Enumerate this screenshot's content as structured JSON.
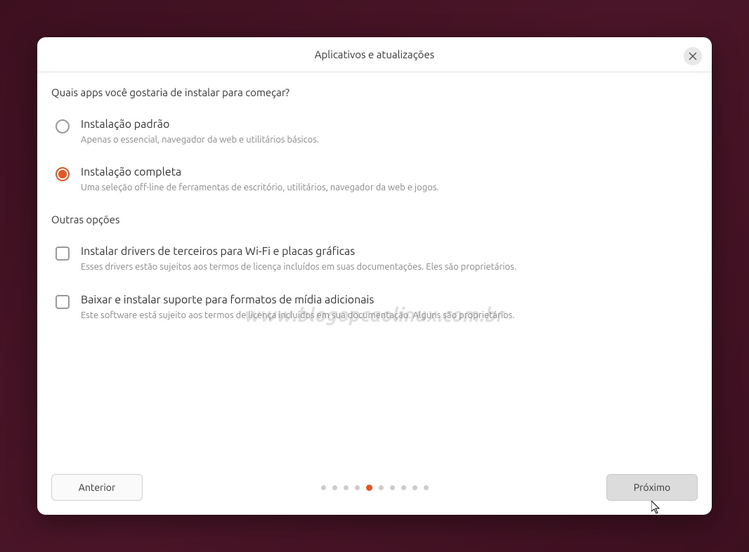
{
  "header": {
    "title": "Aplicativos e atualizações"
  },
  "content": {
    "question": "Quais apps você gostaria de instalar para começar?",
    "options": [
      {
        "title": "Instalação padrão",
        "desc": "Apenas o essencial, navegador da web e utilitários básicos.",
        "selected": false
      },
      {
        "title": "Instalação completa",
        "desc": "Uma seleção off-line de ferramentas de escritório, utilitários, navegador da web e jogos.",
        "selected": true
      }
    ],
    "other_section": "Outras opções",
    "checkboxes": [
      {
        "title": "Instalar drivers de terceiros para Wi-Fi e placas gráficas",
        "desc": "Esses drivers estão sujeitos aos termos de licença incluídos em suas documentações. Eles são proprietários."
      },
      {
        "title": "Baixar e instalar suporte para formatos de mídia adicionais",
        "desc": "Este software está sujeito aos termos de licença incluídos em sua documentação. Alguns são proprietários."
      }
    ]
  },
  "footer": {
    "previous": "Anterior",
    "next": "Próximo"
  },
  "progress": {
    "total": 10,
    "current": 5
  },
  "watermark": "www.blogopcaolinux.com.br"
}
